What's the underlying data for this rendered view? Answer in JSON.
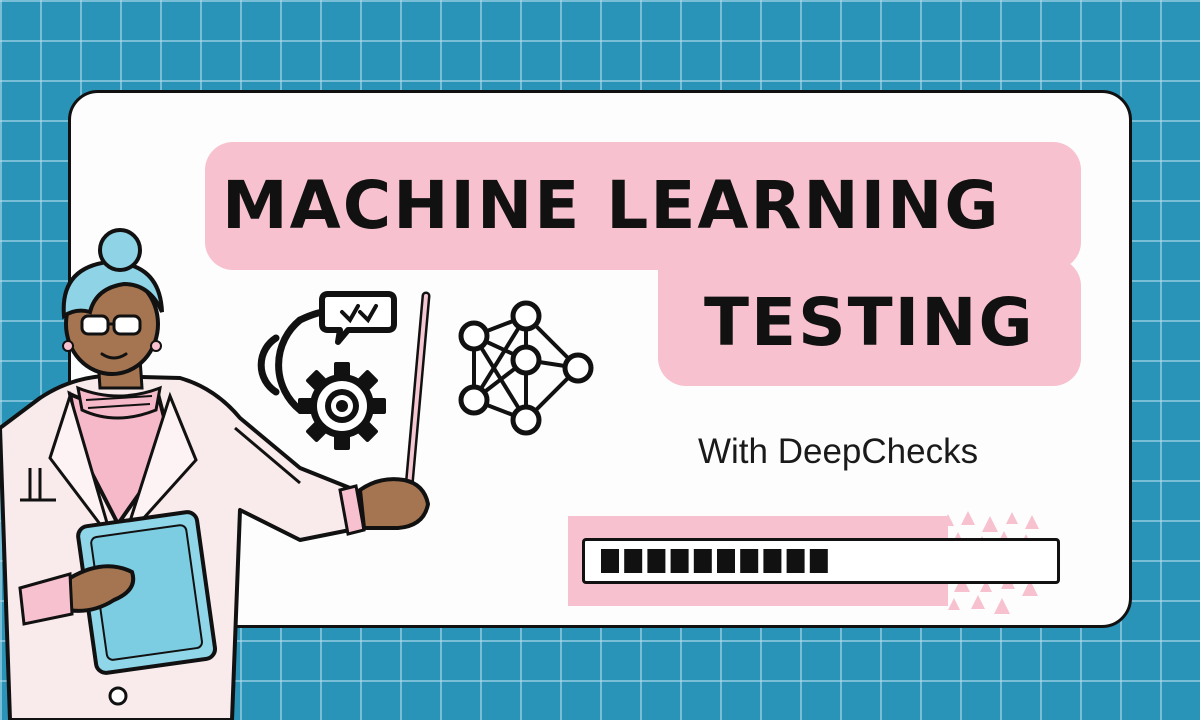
{
  "title": {
    "line1": "MACHINE LEARNING",
    "line2": "TESTING"
  },
  "subtitle": "With DeepChecks",
  "loading": {
    "filled_segments": 10,
    "total_segments": 14
  },
  "colors": {
    "background": "#2a93b8",
    "card": "#fdfdfd",
    "accent_pink": "#f7c1cf",
    "outline": "#111111",
    "hair": "#8fd3e6",
    "clipboard": "#8fd6e8"
  },
  "icons": [
    "refresh-cycle-icon",
    "chat-check-icon",
    "gear-icon",
    "neural-network-icon"
  ]
}
